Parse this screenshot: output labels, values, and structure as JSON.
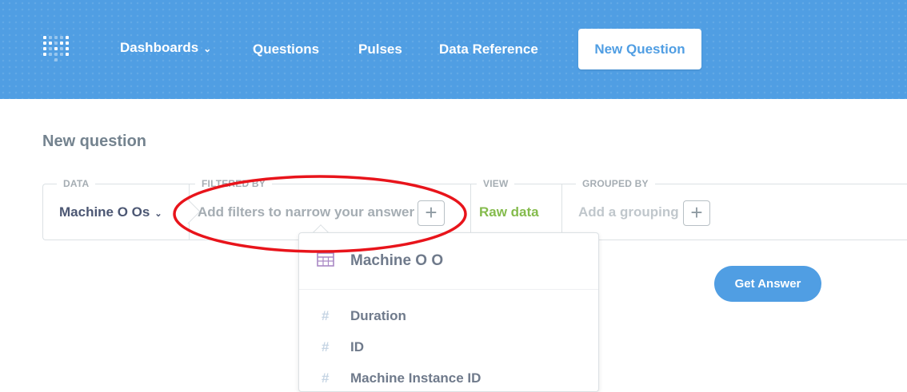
{
  "header": {
    "nav": {
      "dashboards": "Dashboards",
      "questions": "Questions",
      "pulses": "Pulses",
      "data_reference": "Data Reference"
    },
    "new_question_button": "New Question"
  },
  "page": {
    "title": "New question"
  },
  "query_bar": {
    "data": {
      "label": "DATA",
      "value": "Machine O Os"
    },
    "filtered_by": {
      "label": "FILTERED BY",
      "placeholder": "Add filters to narrow your answer"
    },
    "view": {
      "label": "VIEW",
      "value": "Raw data"
    },
    "grouped_by": {
      "label": "GROUPED BY",
      "placeholder": "Add a grouping"
    }
  },
  "filter_popover": {
    "table_name": "Machine O O",
    "fields": [
      {
        "icon": "#",
        "name": "Duration"
      },
      {
        "icon": "#",
        "name": "ID"
      },
      {
        "icon": "#",
        "name": "Machine Instance ID"
      }
    ]
  },
  "get_answer_button": "Get Answer",
  "colors": {
    "brand": "#509ee3",
    "raw_data_green": "#84bb4c",
    "highlight_red": "#e8141b"
  }
}
